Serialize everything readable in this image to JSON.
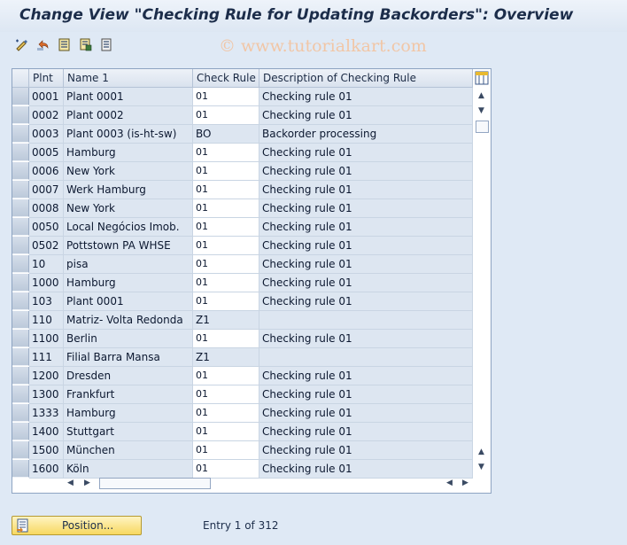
{
  "window": {
    "title": "Change View \"Checking Rule for Updating Backorders\": Overview"
  },
  "watermark": "© www.tutorialkart.com",
  "toolbar": {
    "icons": [
      "edit-pencil-icon",
      "undo-icon",
      "new-entries-icon",
      "copy-icon",
      "delete-icon"
    ]
  },
  "table": {
    "columns": [
      "Plnt",
      "Name 1",
      "Check Rule",
      "Description of Checking Rule"
    ],
    "rows": [
      {
        "plnt": "0001",
        "name": "Plant 0001",
        "rule": "01",
        "desc": "Checking rule 01"
      },
      {
        "plnt": "0002",
        "name": "Plant 0002",
        "rule": "01",
        "desc": "Checking rule 01"
      },
      {
        "plnt": "0003",
        "name": "Plant 0003 (is-ht-sw)",
        "rule": "BO",
        "desc": "Backorder processing"
      },
      {
        "plnt": "0005",
        "name": "Hamburg",
        "rule": "01",
        "desc": "Checking rule 01"
      },
      {
        "plnt": "0006",
        "name": "New York",
        "rule": "01",
        "desc": "Checking rule 01"
      },
      {
        "plnt": "0007",
        "name": "Werk Hamburg",
        "rule": "01",
        "desc": "Checking rule 01"
      },
      {
        "plnt": "0008",
        "name": "New York",
        "rule": "01",
        "desc": "Checking rule 01"
      },
      {
        "plnt": "0050",
        "name": "Local Negócios Imob.",
        "rule": "01",
        "desc": "Checking rule 01"
      },
      {
        "plnt": "0502",
        "name": "Pottstown PA WHSE",
        "rule": "01",
        "desc": "Checking rule 01"
      },
      {
        "plnt": "10",
        "name": "pisa",
        "rule": "01",
        "desc": "Checking rule 01"
      },
      {
        "plnt": "1000",
        "name": "Hamburg",
        "rule": "01",
        "desc": "Checking rule 01"
      },
      {
        "plnt": "103",
        "name": "Plant 0001",
        "rule": "01",
        "desc": "Checking rule 01"
      },
      {
        "plnt": "110",
        "name": "Matriz- Volta Redonda",
        "rule": "Z1",
        "desc": ""
      },
      {
        "plnt": "1100",
        "name": "Berlin",
        "rule": "01",
        "desc": "Checking rule 01"
      },
      {
        "plnt": "111",
        "name": "Filial Barra Mansa",
        "rule": "Z1",
        "desc": ""
      },
      {
        "plnt": "1200",
        "name": "Dresden",
        "rule": "01",
        "desc": "Checking rule 01"
      },
      {
        "plnt": "1300",
        "name": "Frankfurt",
        "rule": "01",
        "desc": "Checking rule 01"
      },
      {
        "plnt": "1333",
        "name": "Hamburg",
        "rule": "01",
        "desc": "Checking rule 01"
      },
      {
        "plnt": "1400",
        "name": "Stuttgart",
        "rule": "01",
        "desc": "Checking rule 01"
      },
      {
        "plnt": "1500",
        "name": "München",
        "rule": "01",
        "desc": "Checking rule 01"
      },
      {
        "plnt": "1600",
        "name": "Köln",
        "rule": "01",
        "desc": "Checking rule 01"
      }
    ]
  },
  "footer": {
    "position_label": "Position...",
    "entry_text": "Entry 1 of 312"
  },
  "colors": {
    "accent": "#f7d860",
    "readonly_cell": "#dde6f1",
    "background": "#dfe9f5"
  }
}
